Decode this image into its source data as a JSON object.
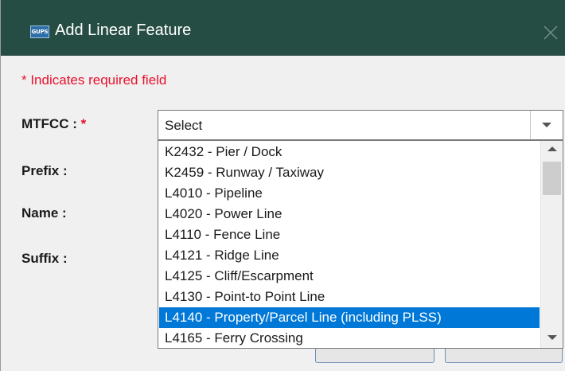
{
  "window": {
    "app_icon_text": "GUPS",
    "title": "Add Linear Feature",
    "close_icon": "close-icon"
  },
  "form": {
    "required_note": "* Indicates required field",
    "labels": {
      "mtfcc": "MTFCC :",
      "prefix": "Prefix :",
      "name": "Name :",
      "suffix": "Suffix :"
    },
    "required_star": "*",
    "mtfcc_select": {
      "value": "Select",
      "expanded": true,
      "options": [
        {
          "label": "K2432 - Pier / Dock"
        },
        {
          "label": "K2459 - Runway / Taxiway"
        },
        {
          "label": "L4010 - Pipeline"
        },
        {
          "label": "L4020 - Power Line"
        },
        {
          "label": "L4110 - Fence Line"
        },
        {
          "label": "L4121 - Ridge Line"
        },
        {
          "label": "L4125 - Cliff/Escarpment"
        },
        {
          "label": "L4130 - Point-to Point Line"
        },
        {
          "label": "L4140 - Property/Parcel Line (including PLSS)",
          "highlighted": true
        },
        {
          "label": "L4165 - Ferry Crossing"
        }
      ]
    }
  },
  "colors": {
    "titlebar": "#264d43",
    "required": "#e8112d",
    "highlight": "#0078d7"
  }
}
